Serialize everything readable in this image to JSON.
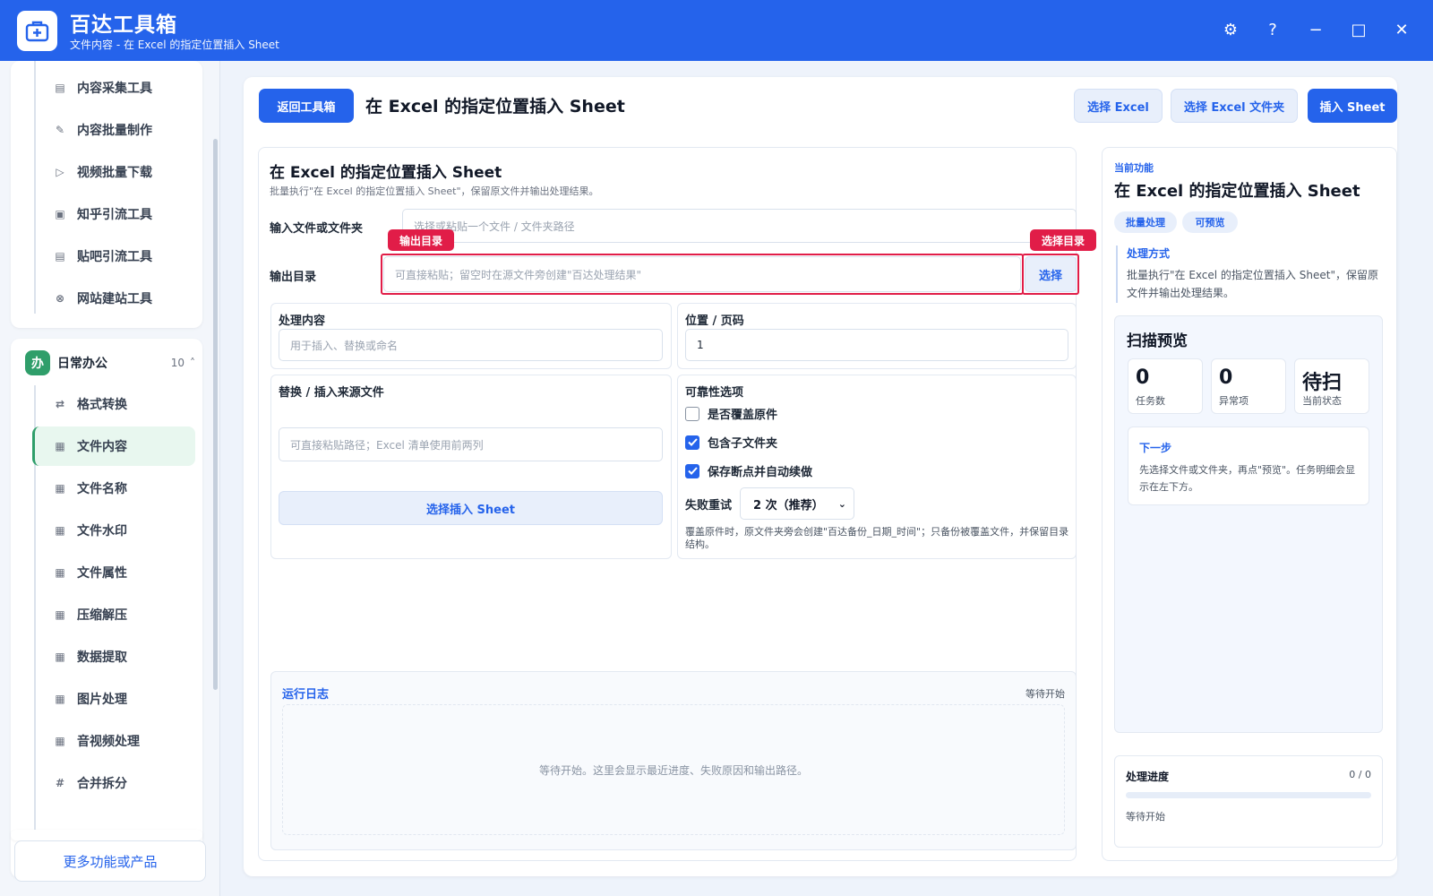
{
  "app": {
    "title": "百达工具箱",
    "subtitle": "文件内容 - 在 Excel 的指定位置插入 Sheet",
    "controls": {
      "settings": "⚙",
      "help": "?",
      "minimize": "−",
      "maximize": "□",
      "close": "✕"
    }
  },
  "sidebar": {
    "top_items": [
      {
        "icon": "▤",
        "label": "内容采集工具"
      },
      {
        "icon": "✎",
        "label": "内容批量制作"
      },
      {
        "icon": "▷",
        "label": "视频批量下载"
      },
      {
        "icon": "▣",
        "label": "知乎引流工具"
      },
      {
        "icon": "▤",
        "label": "贴吧引流工具"
      },
      {
        "icon": "⊗",
        "label": "网站建站工具"
      }
    ],
    "group": {
      "badge": "办",
      "name": "日常办公",
      "count": "10",
      "caret": "˄"
    },
    "group_items": [
      {
        "icon": "⇄",
        "label": "格式转换"
      },
      {
        "icon": "▦",
        "label": "文件内容"
      },
      {
        "icon": "▦",
        "label": "文件名称"
      },
      {
        "icon": "▦",
        "label": "文件水印"
      },
      {
        "icon": "▦",
        "label": "文件属性"
      },
      {
        "icon": "▦",
        "label": "压缩解压"
      },
      {
        "icon": "▦",
        "label": "数据提取"
      },
      {
        "icon": "▦",
        "label": "图片处理"
      },
      {
        "icon": "▦",
        "label": "音视频处理"
      },
      {
        "icon": "#",
        "label": "合并拆分"
      }
    ],
    "more": "更多功能或产品"
  },
  "toolbar": {
    "back": "返回工具箱",
    "title": "在 Excel 的指定位置插入 Sheet",
    "select_excel": "选择 Excel",
    "select_folder": "选择 Excel 文件夹",
    "insert": "插入 Sheet"
  },
  "form": {
    "title": "在 Excel 的指定位置插入 Sheet",
    "description": "批量执行\"在 Excel 的指定位置插入 Sheet\"，保留原文件并输出处理结果。",
    "input_label": "输入文件或文件夹",
    "input_placeholder": "选择或粘贴一个文件 / 文件夹路径",
    "output_label": "输出目录",
    "output_placeholder": "可直接粘贴；留空时在源文件旁创建\"百达处理结果\"",
    "output_tag": "输出目录",
    "choose_tag": "选择目录",
    "choose_btn": "选择",
    "content_label": "处理内容",
    "content_placeholder": "用于插入、替换或命名",
    "position_label": "位置 / 页码",
    "position_value": "1",
    "source_label": "替换 / 插入来源文件",
    "source_placeholder": "可直接粘贴路径；Excel 清单使用前两列",
    "source_btn": "选择插入 Sheet",
    "reliability_label": "可靠性选项",
    "opt_overwrite": "是否覆盖原件",
    "opt_subfolders": "包含子文件夹",
    "opt_resume": "保存断点并自动续做",
    "retry_label": "失败重试",
    "retry_value": "2 次（推荐）",
    "note": "覆盖原件时，原文件夹旁会创建\"百达备份_日期_时间\"；只备份被覆盖文件，并保留目录结构。"
  },
  "log": {
    "title": "运行日志",
    "status": "等待开始",
    "empty": "等待开始。这里会显示最近进度、失败原因和输出路径。"
  },
  "right": {
    "eyebrow": "当前功能",
    "title": "在 Excel 的指定位置插入 Sheet",
    "chips": [
      "批量处理",
      "可预览"
    ],
    "method_title": "处理方式",
    "method_text": "批量执行\"在 Excel 的指定位置插入 Sheet\"，保留原文件并输出处理结果。",
    "scan_title": "扫描预览",
    "stats": [
      {
        "num": "0",
        "cap": "任务数"
      },
      {
        "num": "0",
        "cap": "异常项"
      },
      {
        "num": "待扫",
        "cap": "当前状态"
      }
    ],
    "next_title": "下一步",
    "next_text": "先选择文件或文件夹，再点\"预览\"。任务明细会显示在左下方。",
    "progress_title": "处理进度",
    "progress_count": "0 / 0",
    "progress_fraction": 0,
    "progress_status": "等待开始"
  },
  "colors": {
    "brand": "#2563eb",
    "accent_green": "#2f9e6a",
    "highlight": "#e11d48"
  },
  "checkbox_states": {
    "overwrite": false,
    "subfolders": true,
    "resume": true
  }
}
